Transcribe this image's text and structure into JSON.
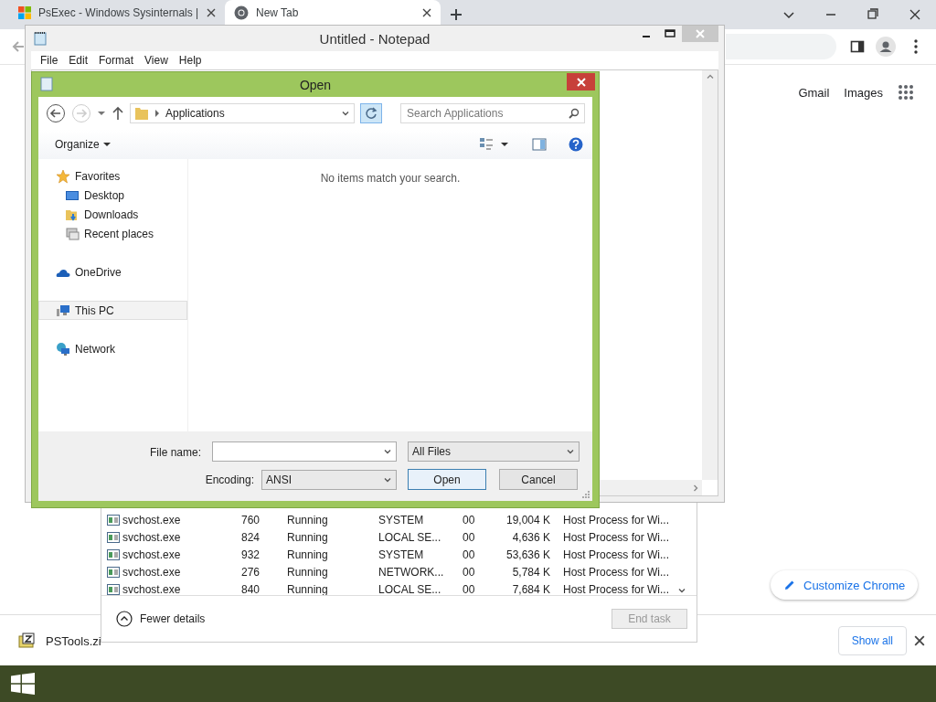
{
  "browser": {
    "tabs": [
      {
        "title": "PsExec - Windows Sysinternals |",
        "selected": false
      },
      {
        "title": "New Tab",
        "selected": true
      }
    ],
    "links": [
      "Gmail",
      "Images"
    ],
    "customize_button": "Customize Chrome",
    "downloads": {
      "file": "PSTools.zi",
      "show_all": "Show all"
    }
  },
  "task_manager": {
    "rows": [
      {
        "name": "svchost.exe",
        "pid": "760",
        "status": "Running",
        "user": "SYSTEM",
        "cpu": "00",
        "memory": "19,004 K",
        "description": "Host Process for Wi..."
      },
      {
        "name": "svchost.exe",
        "pid": "824",
        "status": "Running",
        "user": "LOCAL SE...",
        "cpu": "00",
        "memory": "4,636 K",
        "description": "Host Process for Wi..."
      },
      {
        "name": "svchost.exe",
        "pid": "932",
        "status": "Running",
        "user": "SYSTEM",
        "cpu": "00",
        "memory": "53,636 K",
        "description": "Host Process for Wi..."
      },
      {
        "name": "svchost.exe",
        "pid": "276",
        "status": "Running",
        "user": "NETWORK...",
        "cpu": "00",
        "memory": "5,784 K",
        "description": "Host Process for Wi..."
      },
      {
        "name": "svchost.exe",
        "pid": "840",
        "status": "Running",
        "user": "LOCAL SE...",
        "cpu": "00",
        "memory": "7,684 K",
        "description": "Host Process for Wi..."
      }
    ],
    "fewer_details": "Fewer details",
    "end_task": {
      "label": "End task",
      "disabled": true
    }
  },
  "notepad": {
    "title": "Untitled - Notepad",
    "menu": [
      "File",
      "Edit",
      "Format",
      "View",
      "Help"
    ]
  },
  "open_dialog": {
    "title": "Open",
    "location": "Applications",
    "search": {
      "placeholder": "Search Applications"
    },
    "organize": "Organize",
    "nav": [
      {
        "label": "Favorites",
        "selected": false,
        "children": [
          {
            "label": "Desktop",
            "selected": false
          },
          {
            "label": "Downloads",
            "selected": false
          },
          {
            "label": "Recent places",
            "selected": false
          }
        ]
      },
      {
        "label": "OneDrive",
        "selected": false
      },
      {
        "label": "This PC",
        "selected": true
      },
      {
        "label": "Network",
        "selected": false
      }
    ],
    "empty_message": "No items match your search.",
    "file_name_label": "File name:",
    "file_type": "All Files",
    "encoding_label": "Encoding:",
    "encoding": "ANSI",
    "buttons": [
      "Open",
      "Cancel"
    ]
  }
}
